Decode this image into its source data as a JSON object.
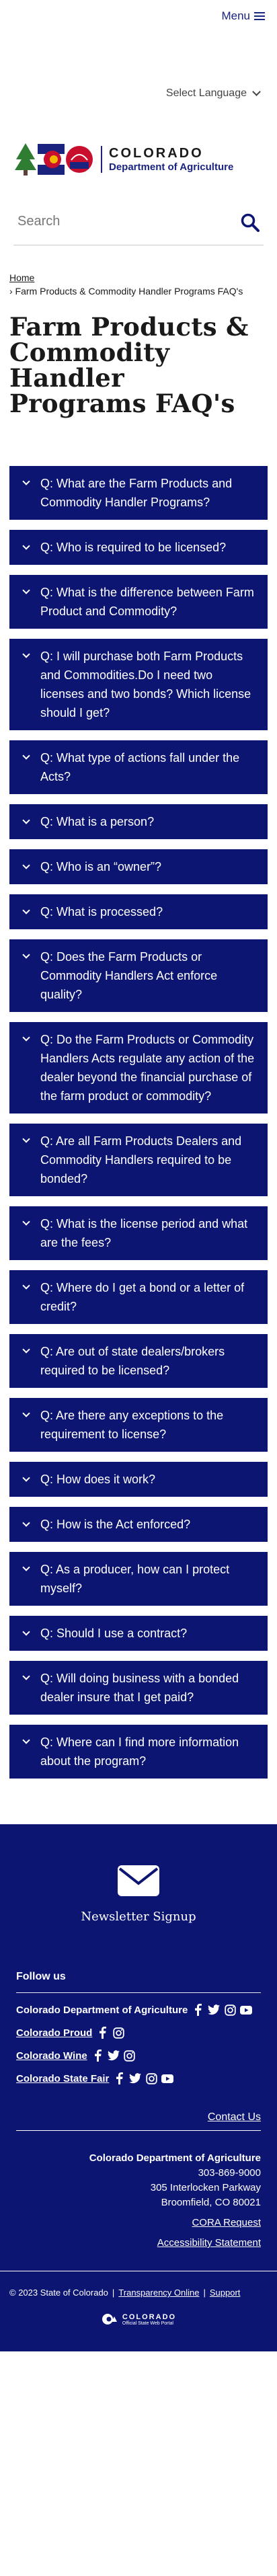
{
  "header": {
    "menu_label": "Menu",
    "language_label": "Select Language",
    "logo": {
      "state": "COLORADO",
      "department": "Department of Agriculture",
      "badge_text": "CDA"
    },
    "search": {
      "placeholder": "Search"
    }
  },
  "breadcrumb": {
    "home": "Home",
    "current": "› Farm Products & Commodity Handler Programs FAQ's"
  },
  "page_title": "Farm Products & Commodity Handler Programs FAQ's",
  "faqs": [
    "Q: What are the Farm Products and Commodity Handler Programs?",
    "Q: Who is required to be licensed?",
    "Q: What is the difference between Farm Product and Commodity?",
    "Q: I will purchase both Farm Products and Commodities.Do I need two licenses and two bonds? Which license should I get?",
    "Q: What type of actions fall under the Acts?",
    "Q: What is a person?",
    "Q: Who is an “owner”?",
    "Q: What is processed?",
    "Q: Does the Farm Products or Commodity Handlers Act enforce quality?",
    "Q: Do the Farm Products or Commodity Handlers Acts regulate any action of the dealer beyond the financial purchase of the farm product or commodity?",
    "Q: Are all Farm Products Dealers and Commodity Handlers required to be bonded?",
    "Q: What is the license period and what are the fees?",
    "Q: Where do I get a bond or a letter of credit?",
    "Q: Are out of state dealers/brokers required to be licensed?",
    "Q: Are there any exceptions to the requirement to license?",
    "Q: How does it work?",
    "Q: How is the Act enforced?",
    "Q: As a producer, how can I protect myself?",
    "Q: Should I use a contract?",
    "Q: Will doing business with a bonded dealer insure that I get paid?",
    "Q: Where can I find more information about the program?"
  ],
  "footer": {
    "newsletter_label": "Newsletter Signup",
    "follow_label": "Follow us",
    "social": [
      {
        "name": "Colorado Department of Agriculture",
        "icons": [
          "facebook-icon",
          "twitter-icon",
          "instagram-icon",
          "youtube-icon"
        ]
      },
      {
        "name": "Colorado Proud",
        "icons": [
          "facebook-icon",
          "instagram-icon"
        ]
      },
      {
        "name": "Colorado Wine",
        "icons": [
          "facebook-icon",
          "twitter-icon",
          "instagram-icon"
        ]
      },
      {
        "name": "Colorado State Fair",
        "icons": [
          "facebook-icon",
          "twitter-icon",
          "instagram-icon",
          "youtube-icon"
        ]
      }
    ],
    "contact_label": "Contact Us",
    "address": {
      "dept": "Colorado Department of Agriculture",
      "phone": "303-869-9000",
      "street": "305 Interlocken Parkway",
      "city": "Broomfield, CO 80021",
      "cora": "CORA Request",
      "accessibility": "Accessibility Statement"
    },
    "copyright": "© 2023 State of Colorado",
    "transparency": "Transparency Online",
    "support": "Support",
    "portal": {
      "title": "COLORADO",
      "subtitle": "Official State Web Portal"
    }
  },
  "colors": {
    "navy": "#0d1573",
    "accent_red": "#c8102e",
    "accent_gold": "#f5b800",
    "tree_green": "#2e7d32"
  }
}
